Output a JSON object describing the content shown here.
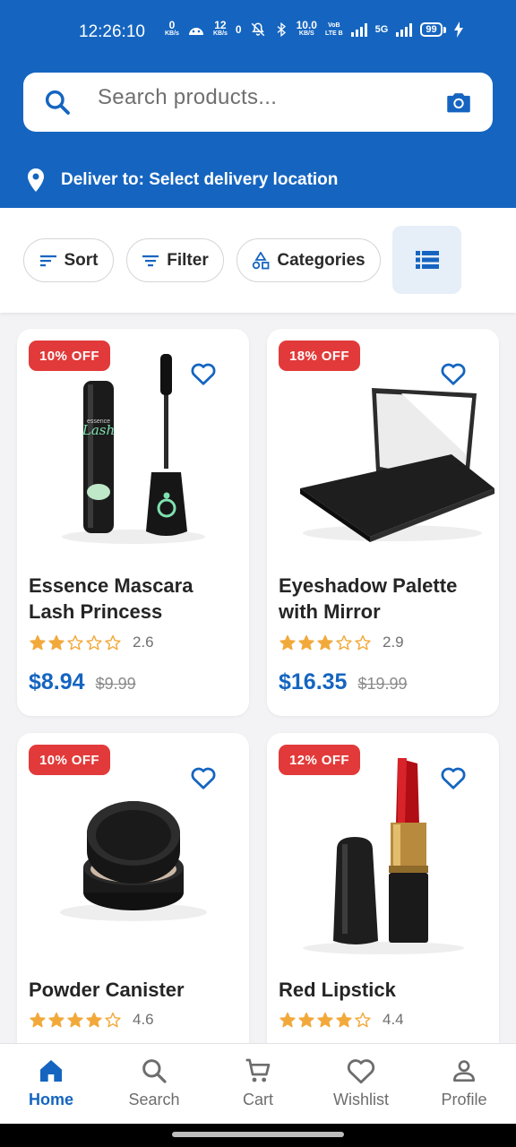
{
  "status": {
    "time": "12:26:10",
    "net1_value": "0",
    "net1_unit": "KB/s",
    "net2_value": "12",
    "net2_unit": "KB/s",
    "net3": "0",
    "speed_value": "10.0",
    "speed_unit": "KB/S",
    "volte_top": "VoB",
    "volte_bottom": "LTE B",
    "lte_label": "5G",
    "battery": "99"
  },
  "search": {
    "placeholder": "Search products..."
  },
  "delivery": {
    "label": "Deliver to: Select delivery location"
  },
  "filters": {
    "sort": "Sort",
    "filter": "Filter",
    "categories": "Categories"
  },
  "products": [
    {
      "name": "Essence Mascara Lash Princess",
      "discount": "10% OFF",
      "rating": 2.6,
      "rating_text": "2.6",
      "price": "$8.94",
      "old_price": "$9.99",
      "image": "mascara"
    },
    {
      "name": "Eyeshadow Palette with Mirror",
      "discount": "18% OFF",
      "rating": 2.9,
      "rating_text": "2.9",
      "price": "$16.35",
      "old_price": "$19.99",
      "image": "eyeshadow-palette"
    },
    {
      "name": "Powder Canister",
      "discount": "10% OFF",
      "rating": 4.6,
      "rating_text": "4.6",
      "image": "powder-canister"
    },
    {
      "name": "Red Lipstick",
      "discount": "12% OFF",
      "rating": 4.4,
      "rating_text": "4.4",
      "image": "red-lipstick"
    }
  ],
  "nav": [
    {
      "label": "Home",
      "icon": "home-icon",
      "active": true
    },
    {
      "label": "Search",
      "icon": "search-icon",
      "active": false
    },
    {
      "label": "Cart",
      "icon": "cart-icon",
      "active": false
    },
    {
      "label": "Wishlist",
      "icon": "heart-icon",
      "active": false
    },
    {
      "label": "Profile",
      "icon": "person-icon",
      "active": false
    }
  ],
  "colors": {
    "primary": "#1565c0",
    "badge": "#e23a3a",
    "star": "#f2a93b",
    "background": "#f3f3f5"
  }
}
